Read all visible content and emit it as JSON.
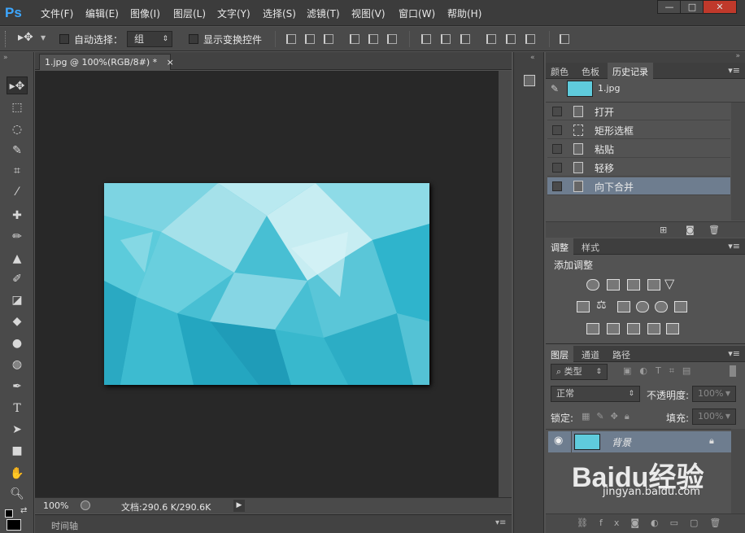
{
  "app": {
    "logo": "Ps"
  },
  "menu": [
    "文件(F)",
    "编辑(E)",
    "图像(I)",
    "图层(L)",
    "文字(Y)",
    "选择(S)",
    "滤镜(T)",
    "视图(V)",
    "窗口(W)",
    "帮助(H)"
  ],
  "window_buttons": {
    "minimize": "—",
    "restore": "□",
    "close": "✕"
  },
  "options": {
    "auto_select": "自动选择：",
    "group_value": "组",
    "show_transform": "显示变换控件"
  },
  "document": {
    "tab": "1.jpg @ 100%(RGB/8#) *",
    "tab_close": "×",
    "zoom": "100%",
    "docinfo": "文档:290.6 K/290.6K",
    "timeline": "时间轴"
  },
  "history": {
    "tabs": [
      "颜色",
      "色板",
      "历史记录"
    ],
    "snapshot": "1.jpg",
    "items": [
      "打开",
      "矩形选框",
      "粘贴",
      "轻移",
      "向下合并"
    ]
  },
  "adjustments": {
    "tabs": [
      "调整",
      "样式"
    ],
    "title": "添加调整"
  },
  "layers": {
    "tabs": [
      "图层",
      "通道",
      "路径"
    ],
    "filter": "类型",
    "blend_mode": "正常",
    "opacity_label": "不透明度:",
    "opacity_value": "100%",
    "lock_label": "锁定:",
    "fill_label": "填充:",
    "fill_value": "100%",
    "layer_name": "背景"
  },
  "watermark": {
    "brand": "Baidu经验",
    "url": "jingyan.baidu.com"
  },
  "colors": {
    "accent": "#3da7ff",
    "selection": "#6e7d8f",
    "image_main": "#4fc3d6"
  }
}
